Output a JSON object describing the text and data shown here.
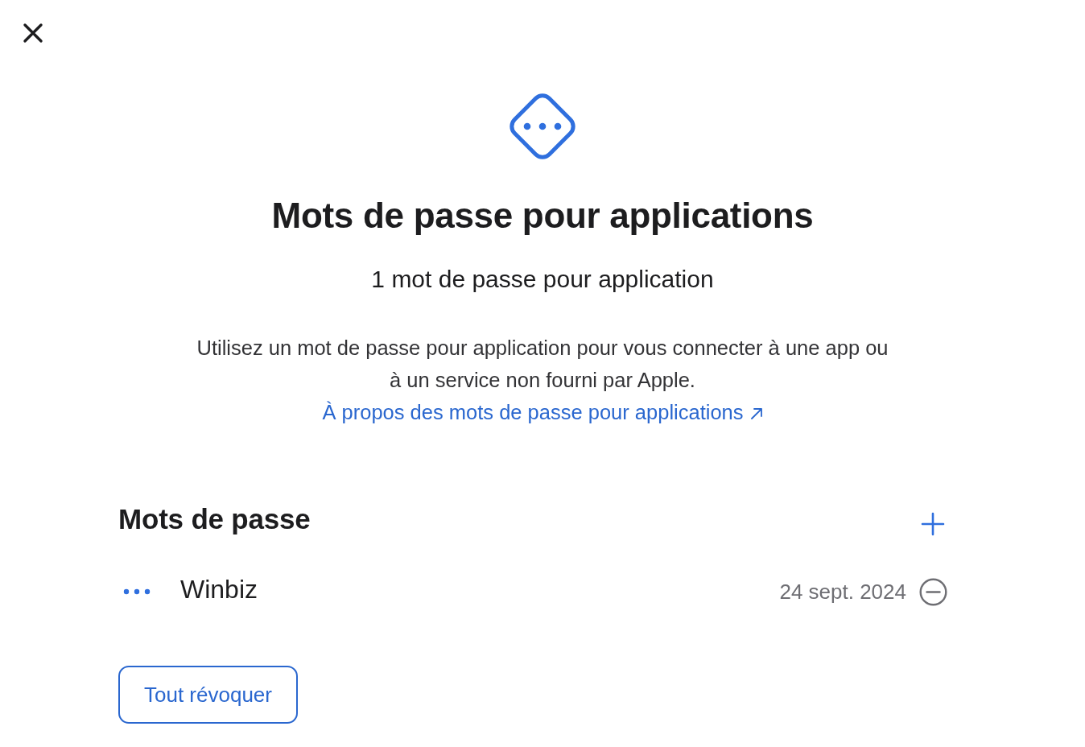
{
  "header": {
    "title": "Mots de passe pour applications",
    "subtitle": "1 mot de passe pour application",
    "description": "Utilisez un mot de passe pour application pour vous connecter à une app ou à un service non fourni par Apple.",
    "link": "À propos des mots de passe pour applications"
  },
  "passwords": {
    "title": "Mots de passe",
    "items": [
      {
        "name": "Winbiz",
        "date": "24 sept. 2024"
      }
    ]
  },
  "buttons": [
    "Tout révoquer"
  ]
}
